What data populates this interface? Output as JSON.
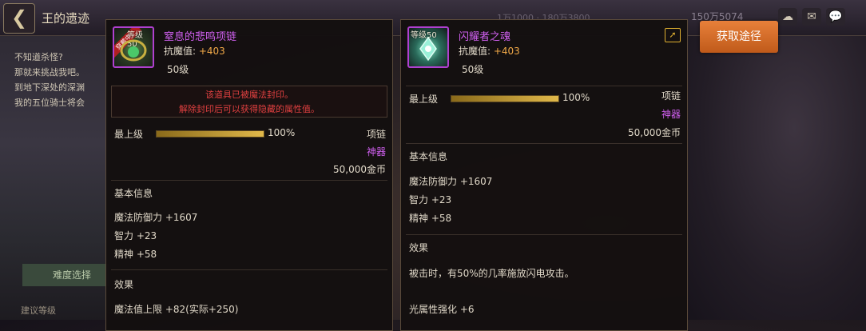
{
  "topbar": {
    "title": "王的遗迹",
    "stats_right": "150万5074",
    "stats_mid": "1万1000 · 180万3800"
  },
  "left_info": {
    "lines": [
      "不知道杀怪?",
      "那就来挑战我吧。",
      "到地下深处的深渊",
      "我的五位骑士将会"
    ],
    "difficulty_tab": "难度选择",
    "recommend_level": "建议等级"
  },
  "item_left": {
    "level_badge": "等级50",
    "equipped_badge": "穿戴中",
    "name": "窒息的悲鸣项链",
    "stat_label": "抗魔值: ",
    "stat_value": "+403",
    "level_text": "50级",
    "seal_line1": "该道具已被魔法封印。",
    "seal_line2": "解除封印后可以获得隐藏的属性值。",
    "upgrade_label": "最上级",
    "upgrade_pct": "100%",
    "upgrade_fill": 1.0,
    "type": "项链",
    "rarity": "神器",
    "price": "50,000金币",
    "basic_header": "基本信息",
    "basic_stats": [
      "魔法防御力 +1607",
      "智力 +23",
      "精神 +58"
    ],
    "effect_header": "效果",
    "effects": [
      "魔法值上限 +82(实际+250)"
    ]
  },
  "item_right": {
    "level_badge": "等级50",
    "name": "闪耀者之魂",
    "stat_label": "抗魔值: ",
    "stat_value": "+403",
    "level_text": "50级",
    "upgrade_label": "最上级",
    "upgrade_pct": "100%",
    "upgrade_fill": 1.0,
    "type": "项链",
    "rarity": "神器",
    "price": "50,000金币",
    "basic_header": "基本信息",
    "basic_stats": [
      "魔法防御力 +1607",
      "智力 +23",
      "精神 +58"
    ],
    "effect_header": "效果",
    "effects": [
      "被击时，有50%的几率施放闪电攻击。",
      "光属性强化 +6"
    ]
  },
  "buttons": {
    "get_source": "获取途径"
  },
  "icons": [
    "back-arrow-icon",
    "share-icon",
    "mail-icon",
    "chat-icon",
    "cloud-icon",
    "necklace-icon",
    "soul-gem-icon"
  ],
  "colors": {
    "epic_name": "#d060f0",
    "stat_value": "#f0a848",
    "seal_text": "#e04040",
    "button": "#d86a28"
  }
}
